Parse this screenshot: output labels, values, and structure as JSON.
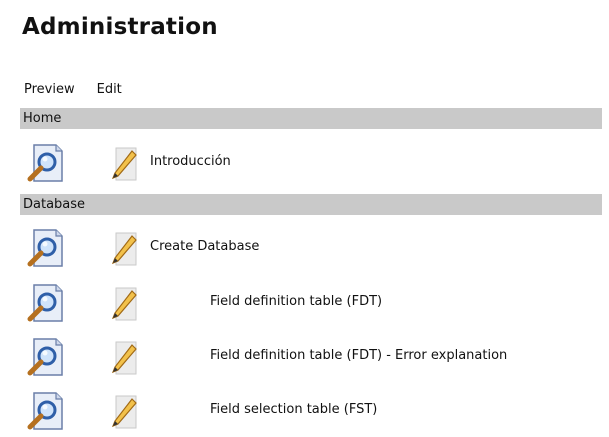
{
  "page": {
    "title": "Administration"
  },
  "columns": {
    "preview": "Preview",
    "edit": "Edit"
  },
  "sections": [
    {
      "name": "Home",
      "items": [
        {
          "label": "Introducción",
          "level": 0
        }
      ]
    },
    {
      "name": "Database",
      "items": [
        {
          "label": "Create Database",
          "level": 0
        },
        {
          "label": "Field definition table (FDT)",
          "level": 1
        },
        {
          "label": "Field definition table (FDT) - Error explanation",
          "level": 1
        },
        {
          "label": "Field selection table (FST)",
          "level": 1
        }
      ]
    }
  ],
  "icons": {
    "preview": "magnifier-document-icon",
    "edit": "pencil-icon"
  }
}
